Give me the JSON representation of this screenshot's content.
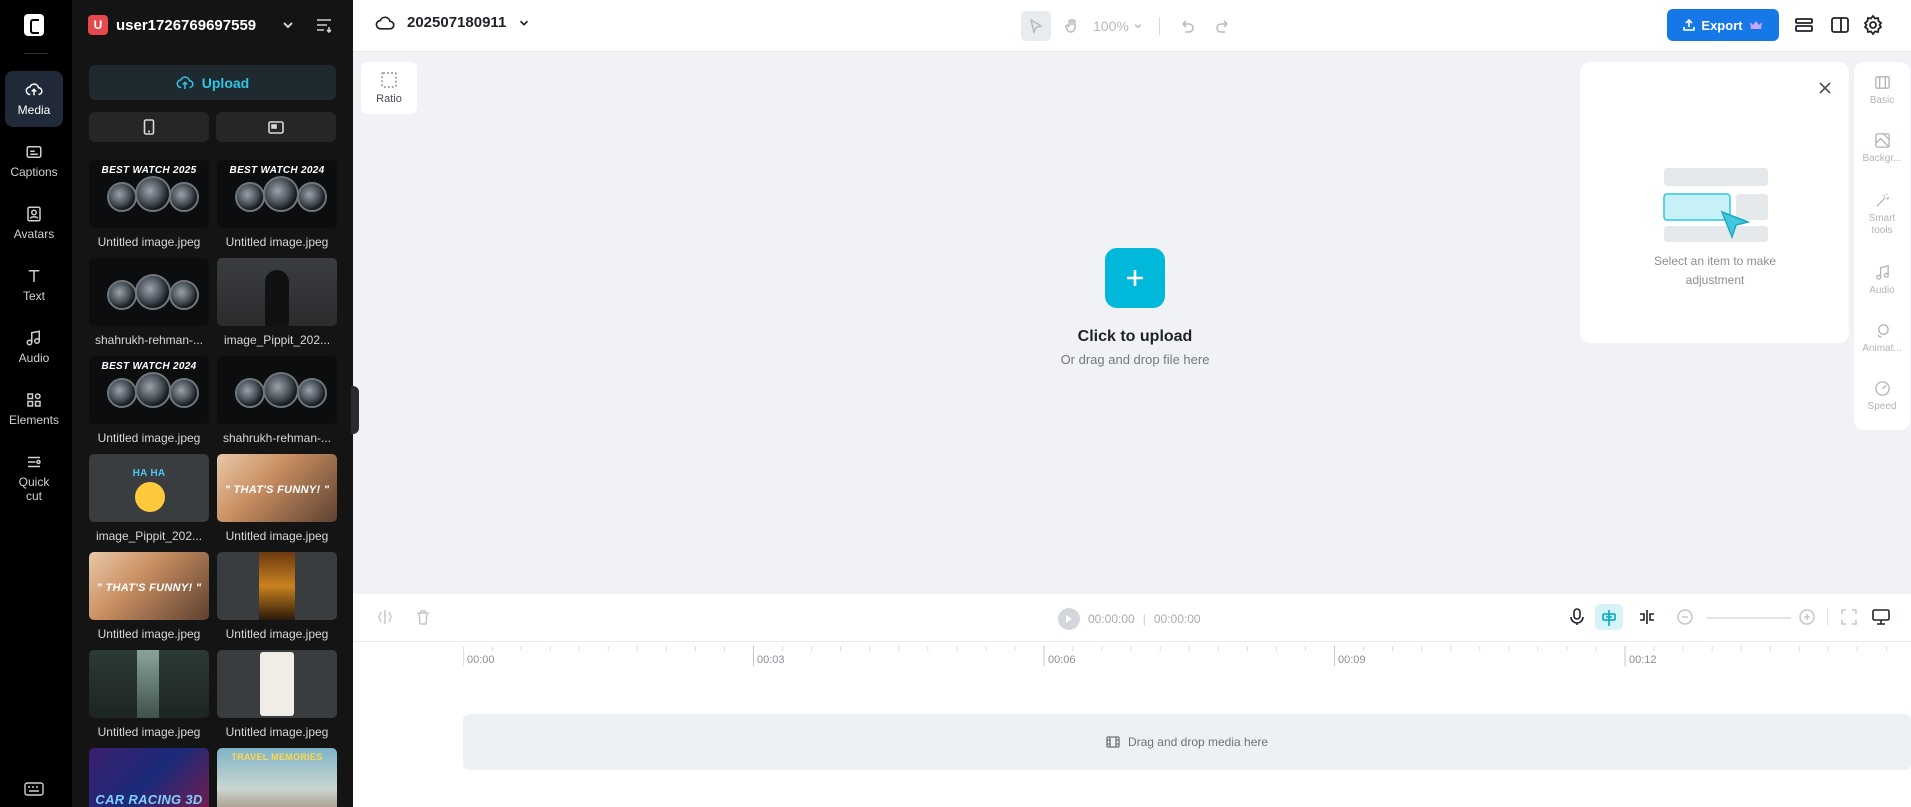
{
  "rail": {
    "items": [
      {
        "label": "Media"
      },
      {
        "label": "Captions"
      },
      {
        "label": "Avatars"
      },
      {
        "label": "Text"
      },
      {
        "label": "Audio"
      },
      {
        "label": "Elements"
      },
      {
        "label": "Quick cut"
      }
    ]
  },
  "panel": {
    "avatar_letter": "U",
    "username": "user1726769697559",
    "upload_label": "Upload",
    "media": [
      {
        "label": "Untitled image.jpeg",
        "overlay": "BEST WATCH 2025",
        "kind": "watch"
      },
      {
        "label": "Untitled image.jpeg",
        "overlay": "BEST WATCH 2024",
        "kind": "watch"
      },
      {
        "label": "shahrukh-rehman-...",
        "overlay": "",
        "kind": "watch"
      },
      {
        "label": "image_Pippit_202...",
        "overlay": "",
        "kind": "person"
      },
      {
        "label": "Untitled image.jpeg",
        "overlay": "BEST WATCH 2024",
        "kind": "watch"
      },
      {
        "label": "shahrukh-rehman-...",
        "overlay": "",
        "kind": "watch"
      },
      {
        "label": "image_Pippit_202...",
        "overlay": "HA HA",
        "kind": "emoji"
      },
      {
        "label": "Untitled image.jpeg",
        "overlay": "\" THAT'S FUNNY! \"",
        "kind": "faces"
      },
      {
        "label": "Untitled image.jpeg",
        "overlay": "\" THAT'S FUNNY! \"",
        "kind": "faces"
      },
      {
        "label": "Untitled image.jpeg",
        "overlay": "",
        "kind": "burger"
      },
      {
        "label": "Untitled image.jpeg",
        "overlay": "",
        "kind": "waterfall"
      },
      {
        "label": "Untitled image.jpeg",
        "overlay": "",
        "kind": "phone"
      },
      {
        "label": "",
        "overlay": "CAR RACING 3D",
        "kind": "racing"
      },
      {
        "label": "",
        "overlay": "TRAVEL MEMORIES",
        "kind": "travel"
      }
    ]
  },
  "topbar": {
    "project_name": "202507180911",
    "zoom": "100%",
    "export_label": "Export"
  },
  "canvas": {
    "ratio_label": "Ratio",
    "upload_title": "Click to upload",
    "upload_sub": "Or drag and drop file here"
  },
  "adjust": {
    "hint": "Select an item to make adjustment"
  },
  "props": [
    {
      "label": "Basic"
    },
    {
      "label": "Backgr..."
    },
    {
      "label": "Smart tools"
    },
    {
      "label": "Audio"
    },
    {
      "label": "Animat..."
    },
    {
      "label": "Speed"
    }
  ],
  "timeline": {
    "current": "00:00:00",
    "total": "00:00:00",
    "ticks": [
      "00:00",
      "00:03",
      "00:06",
      "00:09",
      "00:12"
    ],
    "dropzone": "Drag and drop media here"
  },
  "colors": {
    "accent": "#00b8d9",
    "export": "#1677e6"
  }
}
